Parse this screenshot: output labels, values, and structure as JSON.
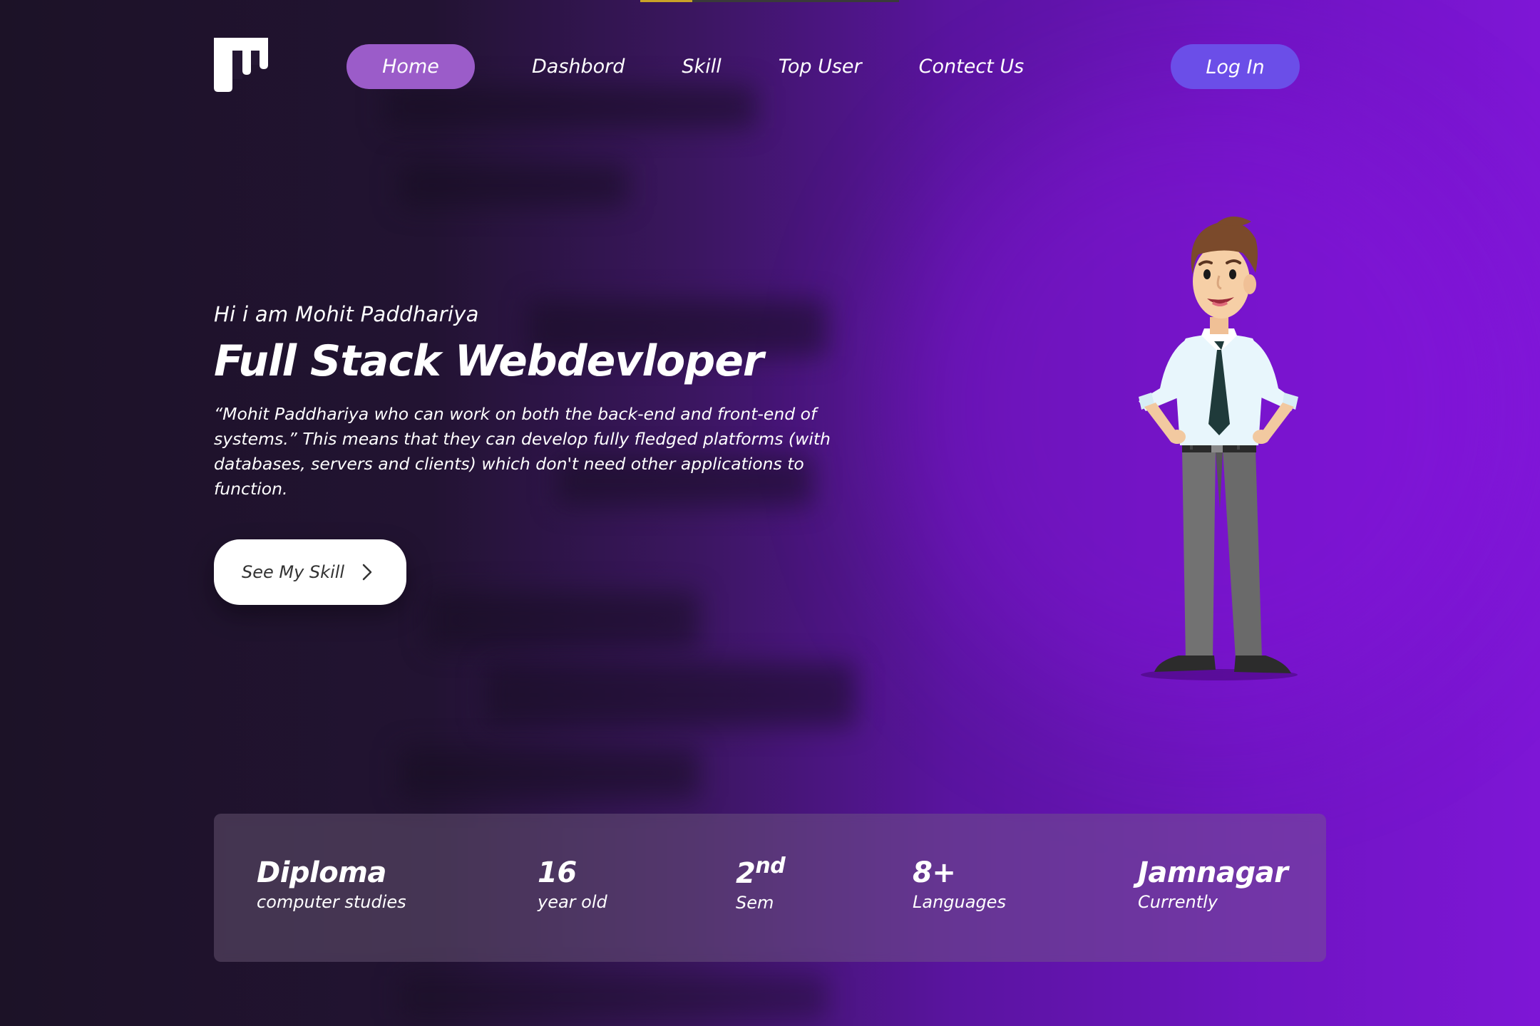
{
  "nav": {
    "logo_icon": "m-logo-icon",
    "items": [
      {
        "label": "Home",
        "active": true
      },
      {
        "label": "Dashbord",
        "active": false
      },
      {
        "label": "Skill",
        "active": false
      },
      {
        "label": "Top User",
        "active": false
      },
      {
        "label": "Contect Us",
        "active": false
      }
    ],
    "login_label": "Log In"
  },
  "hero": {
    "greeting": "Hi i am Mohit Paddhariya",
    "title": "Full Stack Webdevloper",
    "description": "“Mohit Paddhariya who can work on both the back-end and front-end of systems.” This means that they can develop fully fledged platforms (with databases, servers and clients) which don't need other applications to function.",
    "cta_label": "See My Skill",
    "cta_icon": "chevron-right-icon",
    "illustration": "businessman-illustration"
  },
  "stats": [
    {
      "value": "Diploma",
      "sup": "",
      "label": "computer studies"
    },
    {
      "value": "16",
      "sup": "",
      "label": "year old"
    },
    {
      "value": "2",
      "sup": "nd",
      "label": "Sem"
    },
    {
      "value": "8+",
      "sup": "",
      "label": "Languages"
    },
    {
      "value": "Jamnagar",
      "sup": "",
      "label": "Currently"
    }
  ],
  "colors": {
    "active_nav_bg": "#9b5cc9",
    "login_bg": "#6b4ee8",
    "bg_dark": "#1c1227",
    "bg_purple": "#7e16d6"
  }
}
